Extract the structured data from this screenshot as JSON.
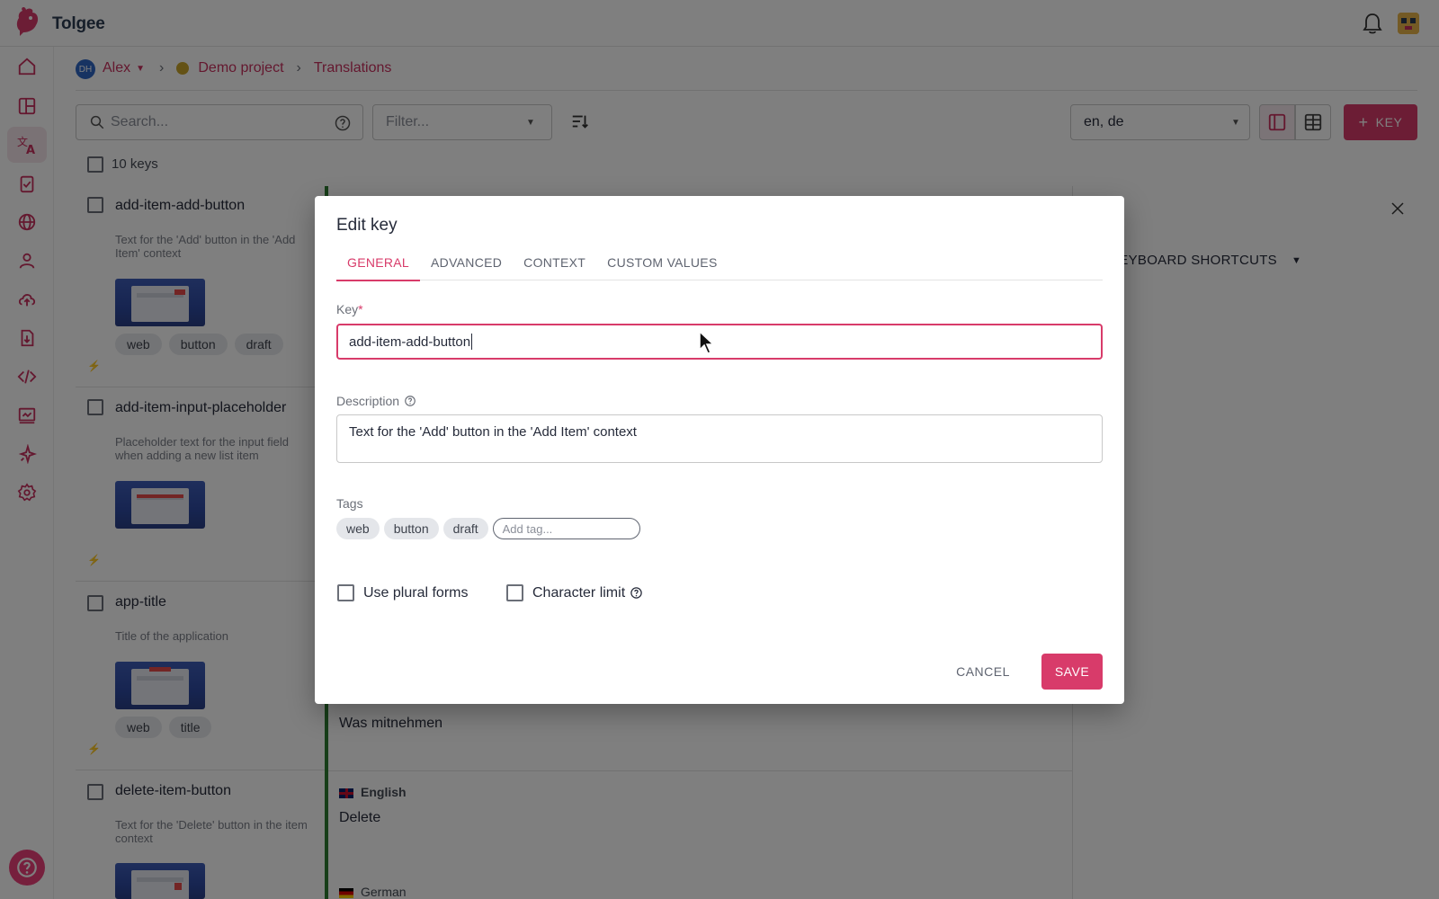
{
  "app": {
    "name": "Tolgee"
  },
  "breadcrumb": {
    "user_initials": "DH",
    "user": "Alex",
    "project": "Demo project",
    "page": "Translations"
  },
  "toolbar": {
    "search_placeholder": "Search...",
    "filter_placeholder": "Filter...",
    "languages": "en, de",
    "add_key_label": "KEY",
    "keys_count": "10 keys"
  },
  "keys": [
    {
      "name": "add-item-add-button",
      "description": "Text for the 'Add' button in the 'Add Item' context",
      "tags": [
        "web",
        "button",
        "draft"
      ]
    },
    {
      "name": "add-item-input-placeholder",
      "description": "Placeholder text for the input field when adding a new list item",
      "tags": []
    },
    {
      "name": "app-title",
      "description": "Title of the application",
      "tags": [
        "web",
        "title"
      ]
    },
    {
      "name": "delete-item-button",
      "description": "Text for the 'Delete' button in the item context",
      "tags": []
    }
  ],
  "translations": {
    "app_title_de": "Was mitnehmen",
    "english_label": "English",
    "delete_en": "Delete",
    "german_label": "German"
  },
  "right_panel": {
    "shortcuts_label": "KEYBOARD SHORTCUTS"
  },
  "dialog": {
    "title": "Edit key",
    "tabs": [
      "GENERAL",
      "ADVANCED",
      "CONTEXT",
      "CUSTOM VALUES"
    ],
    "active_tab": "GENERAL",
    "key_label": "Key",
    "key_required_mark": "*",
    "key_value": "add-item-add-button",
    "description_label": "Description",
    "description_value": "Text for the 'Add' button in the 'Add Item' context",
    "tags_label": "Tags",
    "tags": [
      "web",
      "button",
      "draft"
    ],
    "add_tag_placeholder": "Add tag...",
    "plural_label": "Use plural forms",
    "char_limit_label": "Character limit",
    "cancel_label": "CANCEL",
    "save_label": "SAVE"
  },
  "colors": {
    "accent": "#d83b6a",
    "nav_icon": "#c9305f",
    "green": "#2e7d32"
  },
  "icons": [
    "home-icon",
    "dashboard-icon",
    "translate-icon",
    "tasks-icon",
    "globe-icon",
    "user-icon",
    "upload-icon",
    "export-icon",
    "code-icon",
    "monitor-icon",
    "sparkle-icon",
    "gear-icon",
    "help-icon",
    "bell-icon"
  ]
}
